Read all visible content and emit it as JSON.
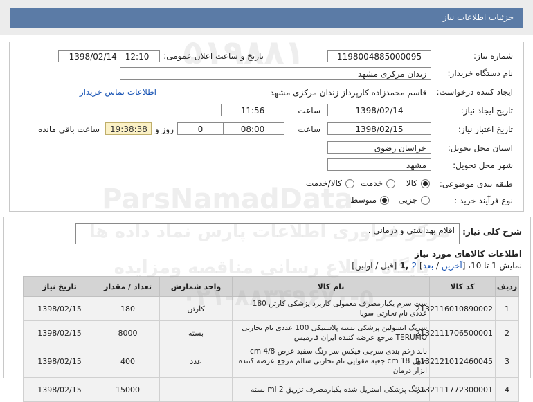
{
  "header": {
    "title": "جزئیات اطلاعات نیاز"
  },
  "form": {
    "need_number_label": "شماره نیاز:",
    "need_number": "1198004885000095",
    "announce_label": "تاریخ و ساعت اعلان عمومی:",
    "announce_value": "1398/02/14 - 12:10",
    "buyer_label": "نام دستگاه خریدار:",
    "buyer_value": "زندان مرکزی مشهد",
    "requester_label": "ایجاد کننده درخواست:",
    "requester_value": "قاسم محمدزاده کارپرداز زندان مرکزی مشهد",
    "contact_link": "اطلاعات تماس خریدار",
    "created_label": "تاریخ ایجاد نیاز:",
    "created_date": "1398/02/14",
    "time_label": "ساعت",
    "created_time": "11:56",
    "valid_label": "تاریخ اعتبار نیاز:",
    "valid_date": "1398/02/15",
    "valid_time": "08:00",
    "days_value": "0",
    "days_label": "روز و",
    "remaining_value": "19:38:38",
    "remaining_label": "ساعت باقی مانده",
    "province_label": "استان محل تحویل:",
    "province_value": "خراسان رضوی",
    "city_label": "شهر محل تحویل:",
    "city_value": "مشهد",
    "category_label": "طبقه بندی موضوعی:",
    "category_options": [
      "کالا",
      "خدمت",
      "کالا/خدمت"
    ],
    "category_selected": 0,
    "process_label": "نوع فرآیند خرید :",
    "process_options": [
      "جزیی",
      "متوسط"
    ],
    "process_selected": 1
  },
  "general": {
    "desc_label": "شرح کلی نیاز:",
    "desc_value": "اقلام بهداشتی و درمانی ."
  },
  "items_section": {
    "title": "اطلاعات کالاهای مورد نیاز",
    "pager_prefix": "نمایش 1 تا 10، [",
    "pager_last": "آخرین",
    "pager_sep1": " / ",
    "pager_next": "بعد",
    "pager_mid": "] ",
    "pager_page2": "2",
    "pager_current": " ,1 ",
    "pager_suffix": "[قبل / اولین]",
    "columns": [
      "ردیف",
      "کد کالا",
      "نام کالا",
      "واحد شمارش",
      "تعداد / مقدار",
      "تاریخ نیاز"
    ],
    "rows": [
      {
        "idx": "1",
        "code": "2132116010890002",
        "name": "ست سرم یکبارمصرف معمولی کاربرد پزشکی کارتن 180 عددی نام تجارتی سوپا",
        "unit": "کارتن",
        "qty": "180",
        "date": "1398/02/15"
      },
      {
        "idx": "2",
        "code": "2132111706500001",
        "name": "سرنگ انسولین پزشکی بسته پلاستیکی 100 عددی نام تجارتی TERUMO مرجع عرضه کننده ایران فارمیس",
        "unit": "بسته",
        "qty": "8000",
        "date": "1398/02/15"
      },
      {
        "idx": "3",
        "code": "2132121012460045",
        "name": "باند زخم بندی سرجی فیکس سر رنگ سفید عرض cm 4/8 طول cm 18 جعبه مقوایی نام تجارتی سالم مرجع عرضه کننده ابزار درمان",
        "unit": "عدد",
        "qty": "400",
        "date": "1398/02/15"
      },
      {
        "idx": "4",
        "code": "2132111772300001",
        "name": "سرنگ پزشکی استریل شده یکبارمصرف تزریق ml 2 بسته",
        "unit": "",
        "qty": "15000",
        "date": "1398/02/15"
      }
    ]
  },
  "watermarks": {
    "site": "ParsNamadData",
    "fa1": "مرکز فراوری اطلاعات پارس نماد داده ها",
    "fa2": "پایگاه اطلاع رسانی مناقصه ومزایده",
    "phone": "۰۲۱-۸۸۳۴۹۶۷۰-۵",
    "code": "۵۱۹۸۸۱"
  }
}
